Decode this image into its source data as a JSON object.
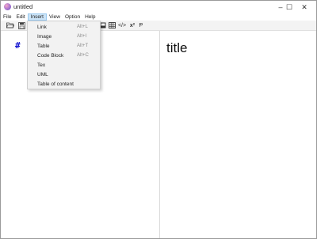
{
  "window": {
    "title": "untitled",
    "controls": {
      "minimize": "–",
      "maximize": "☐",
      "close": "✕"
    }
  },
  "menubar": {
    "items": [
      {
        "label": "File"
      },
      {
        "label": "Edit"
      },
      {
        "label": "Insert"
      },
      {
        "label": "View"
      },
      {
        "label": "Option"
      },
      {
        "label": "Help"
      }
    ]
  },
  "toolbar": {
    "open_glyph": "🗁",
    "save_glyph": "💾",
    "code_glyph": "</>",
    "superscript_label": "x²",
    "paragraph_glyph": "Ᵽ"
  },
  "insert_menu": {
    "items": [
      {
        "label": "Link",
        "shortcut": "Alt+L"
      },
      {
        "label": "Image",
        "shortcut": "Alt+I"
      },
      {
        "label": "Table",
        "shortcut": "Alt+T"
      },
      {
        "label": "Code Block",
        "shortcut": "Alt+C"
      },
      {
        "label": "Tex",
        "shortcut": ""
      },
      {
        "label": "UML",
        "shortcut": ""
      },
      {
        "label": "Table of content",
        "shortcut": ""
      }
    ]
  },
  "editor": {
    "text": "#"
  },
  "preview": {
    "title": "title"
  },
  "colors": {
    "menu_highlight": "#cce4f7",
    "heading_marker": "#1010d0",
    "menu_background": "#f2f2f2"
  }
}
